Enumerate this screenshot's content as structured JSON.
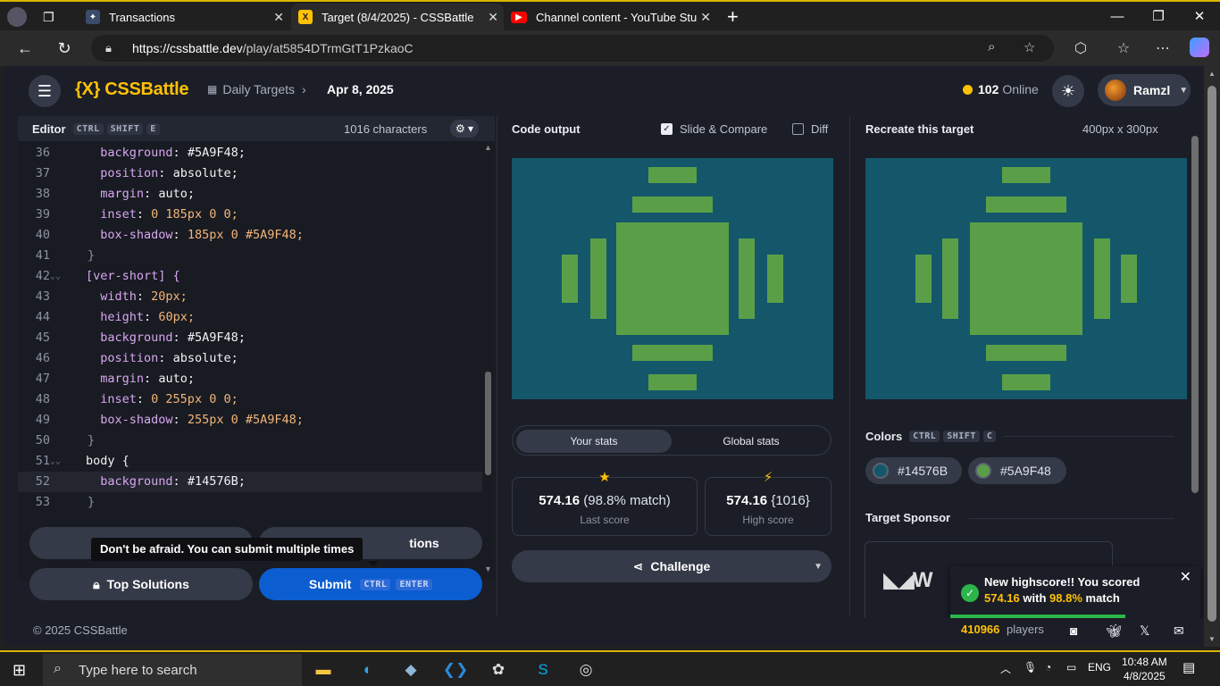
{
  "browser": {
    "tabs": [
      {
        "title": "Transactions"
      },
      {
        "title": "Target (8/4/2025) - CSSBattle"
      },
      {
        "title": "Channel content - YouTube Studio"
      }
    ],
    "url_host": "https://cssbattle.dev",
    "url_path": "/play/at5854DTrmGtT1PzkaoC"
  },
  "header": {
    "logo": "{X} CSSBattle",
    "breadcrumb": "Daily Targets",
    "date": "Apr 8, 2025",
    "online_count": "102",
    "online_label": "Online",
    "username": "Ramzl"
  },
  "editor": {
    "title": "Editor",
    "shortcut": [
      "CTRL",
      "SHIFT",
      "E"
    ],
    "chars": "1016 characters",
    "lines": [
      {
        "n": "36",
        "indent": "  ",
        "prop": "background",
        "val": "#5A9F48;"
      },
      {
        "n": "37",
        "indent": "  ",
        "prop": "position",
        "val": "absolute;"
      },
      {
        "n": "38",
        "indent": "  ",
        "prop": "margin",
        "val": "auto;"
      },
      {
        "n": "39",
        "indent": "  ",
        "prop": "inset",
        "val": "0 185px 0 0;"
      },
      {
        "n": "40",
        "indent": "  ",
        "prop": "box-shadow",
        "val": "185px 0 #5A9F48;"
      },
      {
        "n": "41",
        "raw": "}"
      },
      {
        "n": "42",
        "raw": "[ver-short] {"
      },
      {
        "n": "43",
        "indent": "  ",
        "prop": "width",
        "val": "20px;"
      },
      {
        "n": "44",
        "indent": "  ",
        "prop": "height",
        "val": "60px;"
      },
      {
        "n": "45",
        "indent": "  ",
        "prop": "background",
        "val": "#5A9F48;"
      },
      {
        "n": "46",
        "indent": "  ",
        "prop": "position",
        "val": "absolute;"
      },
      {
        "n": "47",
        "indent": "  ",
        "prop": "margin",
        "val": "auto;"
      },
      {
        "n": "48",
        "indent": "  ",
        "prop": "inset",
        "val": "0 255px 0 0;"
      },
      {
        "n": "49",
        "indent": "  ",
        "prop": "box-shadow",
        "val": "255px 0 #5A9F48;"
      },
      {
        "n": "50",
        "raw": "}"
      },
      {
        "n": "51",
        "raw": "body {"
      },
      {
        "n": "52",
        "indent": "  ",
        "prop": "background",
        "val": "#14576B;"
      },
      {
        "n": "53",
        "raw": "}"
      }
    ],
    "tooltip": "Don't be afraid. You can submit multiple times",
    "solutions_label": "tions",
    "top_solutions": "Top Solutions",
    "submit": "Submit",
    "submit_keys": [
      "CTRL",
      "ENTER"
    ]
  },
  "output": {
    "title": "Code output",
    "slide_compare": "Slide & Compare",
    "diff": "Diff",
    "tabs": [
      "Your stats",
      "Global stats"
    ],
    "last_score_value": "574.16",
    "last_score_match": "(98.8% match)",
    "last_score_label": "Last score",
    "high_score_value": "574.16",
    "high_score_chars": "{1016}",
    "high_score_label": "High score",
    "challenge": "Challenge"
  },
  "target": {
    "title": "Recreate this target",
    "size": "400px x 300px",
    "colors_title": "Colors",
    "colors_keys": [
      "CTRL",
      "SHIFT",
      "C"
    ],
    "colors": [
      "#14576B",
      "#5A9F48"
    ],
    "sponsor_title": "Target Sponsor"
  },
  "toast": {
    "line1": "New highscore!! You scored",
    "score": "574.16",
    "with": "with",
    "match": "98.8%",
    "match_word": "match"
  },
  "footer": {
    "copyright": "© 2025 CSSBattle",
    "players_count": "410966",
    "players_label": "players"
  },
  "taskbar": {
    "search_placeholder": "Type here to search",
    "lang": "ENG",
    "time": "10:48 AM",
    "date": "4/8/2025"
  }
}
